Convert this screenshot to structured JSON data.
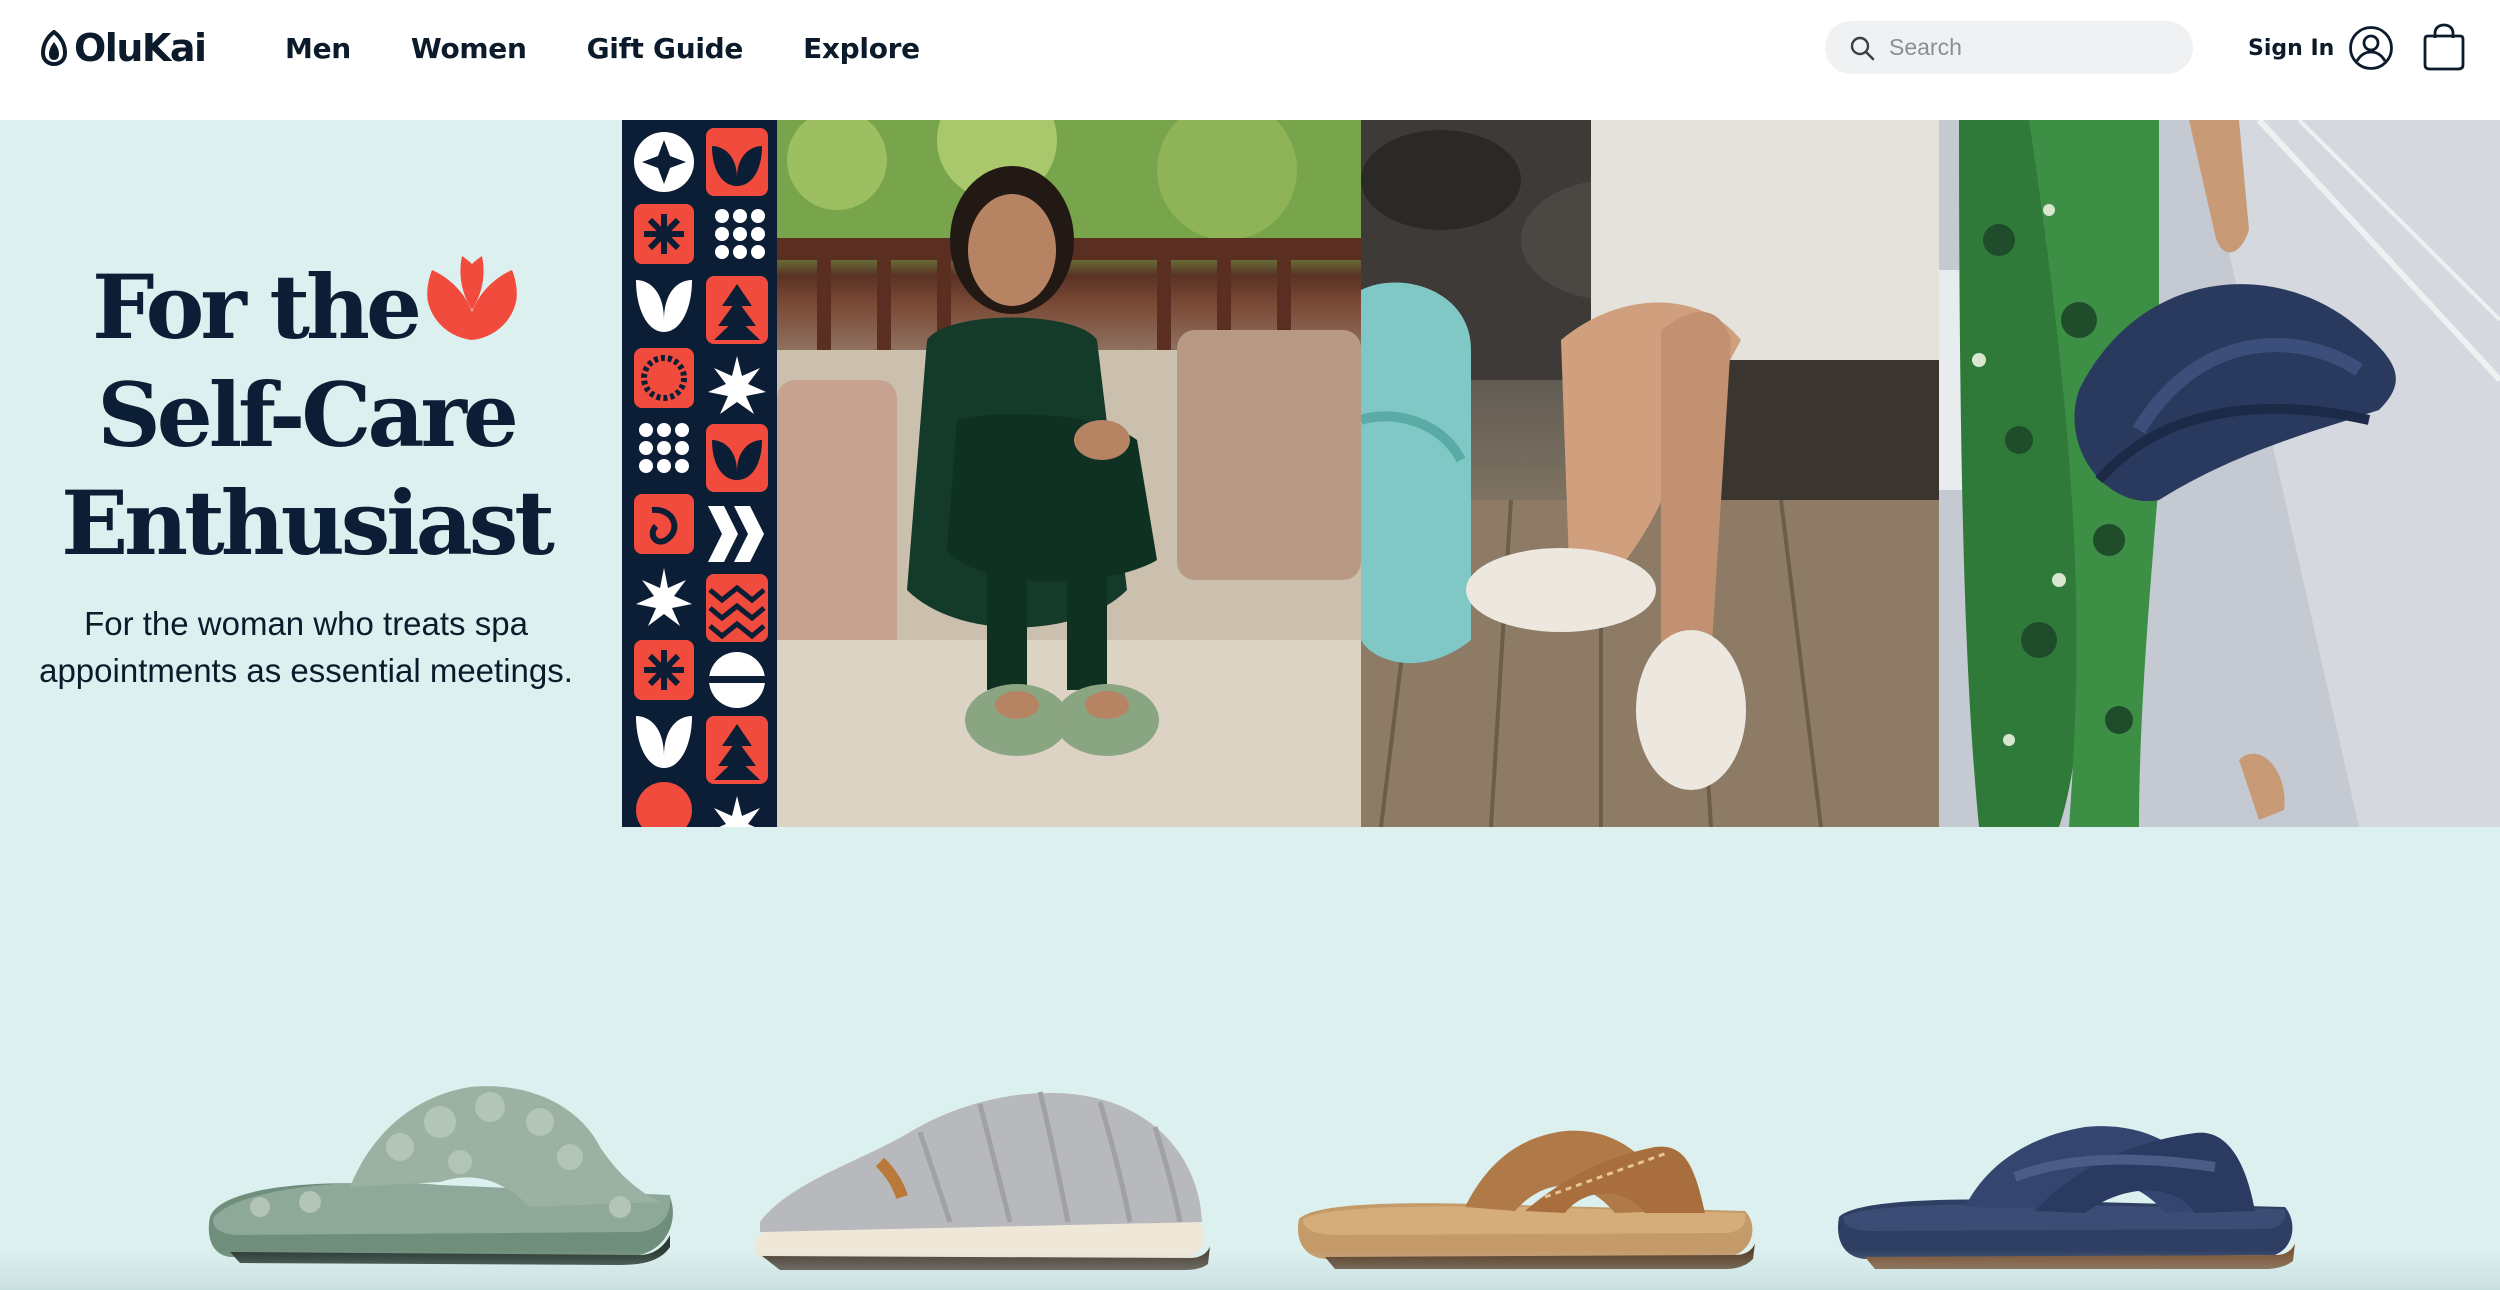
{
  "brand": {
    "name": "OluKai",
    "logo_icon": "olukai-logo-icon"
  },
  "nav": {
    "items": [
      {
        "label": "Men"
      },
      {
        "label": "Women"
      },
      {
        "label": "Gift Guide"
      },
      {
        "label": "Explore"
      }
    ]
  },
  "search": {
    "placeholder": "Search",
    "value": "",
    "icon": "search-icon"
  },
  "account": {
    "signin_label": "Sign In",
    "icon": "user-icon"
  },
  "cart": {
    "icon": "shopping-bag-icon"
  },
  "hero": {
    "title_line1": "For the",
    "title_line2": "Self-Care",
    "title_line3": "Enthusiast",
    "subtitle_line1": "For the woman who treats spa",
    "subtitle_line2": "appointments as essential meetings.",
    "flower_icon": "red-flower-icon",
    "background_color": "#dcf0f0",
    "title_color": "#0c1e35",
    "accent_color": "#f04b3c"
  },
  "products": {
    "items": [
      {
        "name_icon": "sage-fuzzy-slide-slipper",
        "color": "#9bb1a2"
      },
      {
        "name_icon": "grey-shearling-slipper",
        "color": "#b8b9bd"
      },
      {
        "name_icon": "tan-crossover-sandal",
        "color": "#b07a48"
      },
      {
        "name_icon": "navy-crossover-slide",
        "color": "#2f3f63"
      }
    ]
  }
}
